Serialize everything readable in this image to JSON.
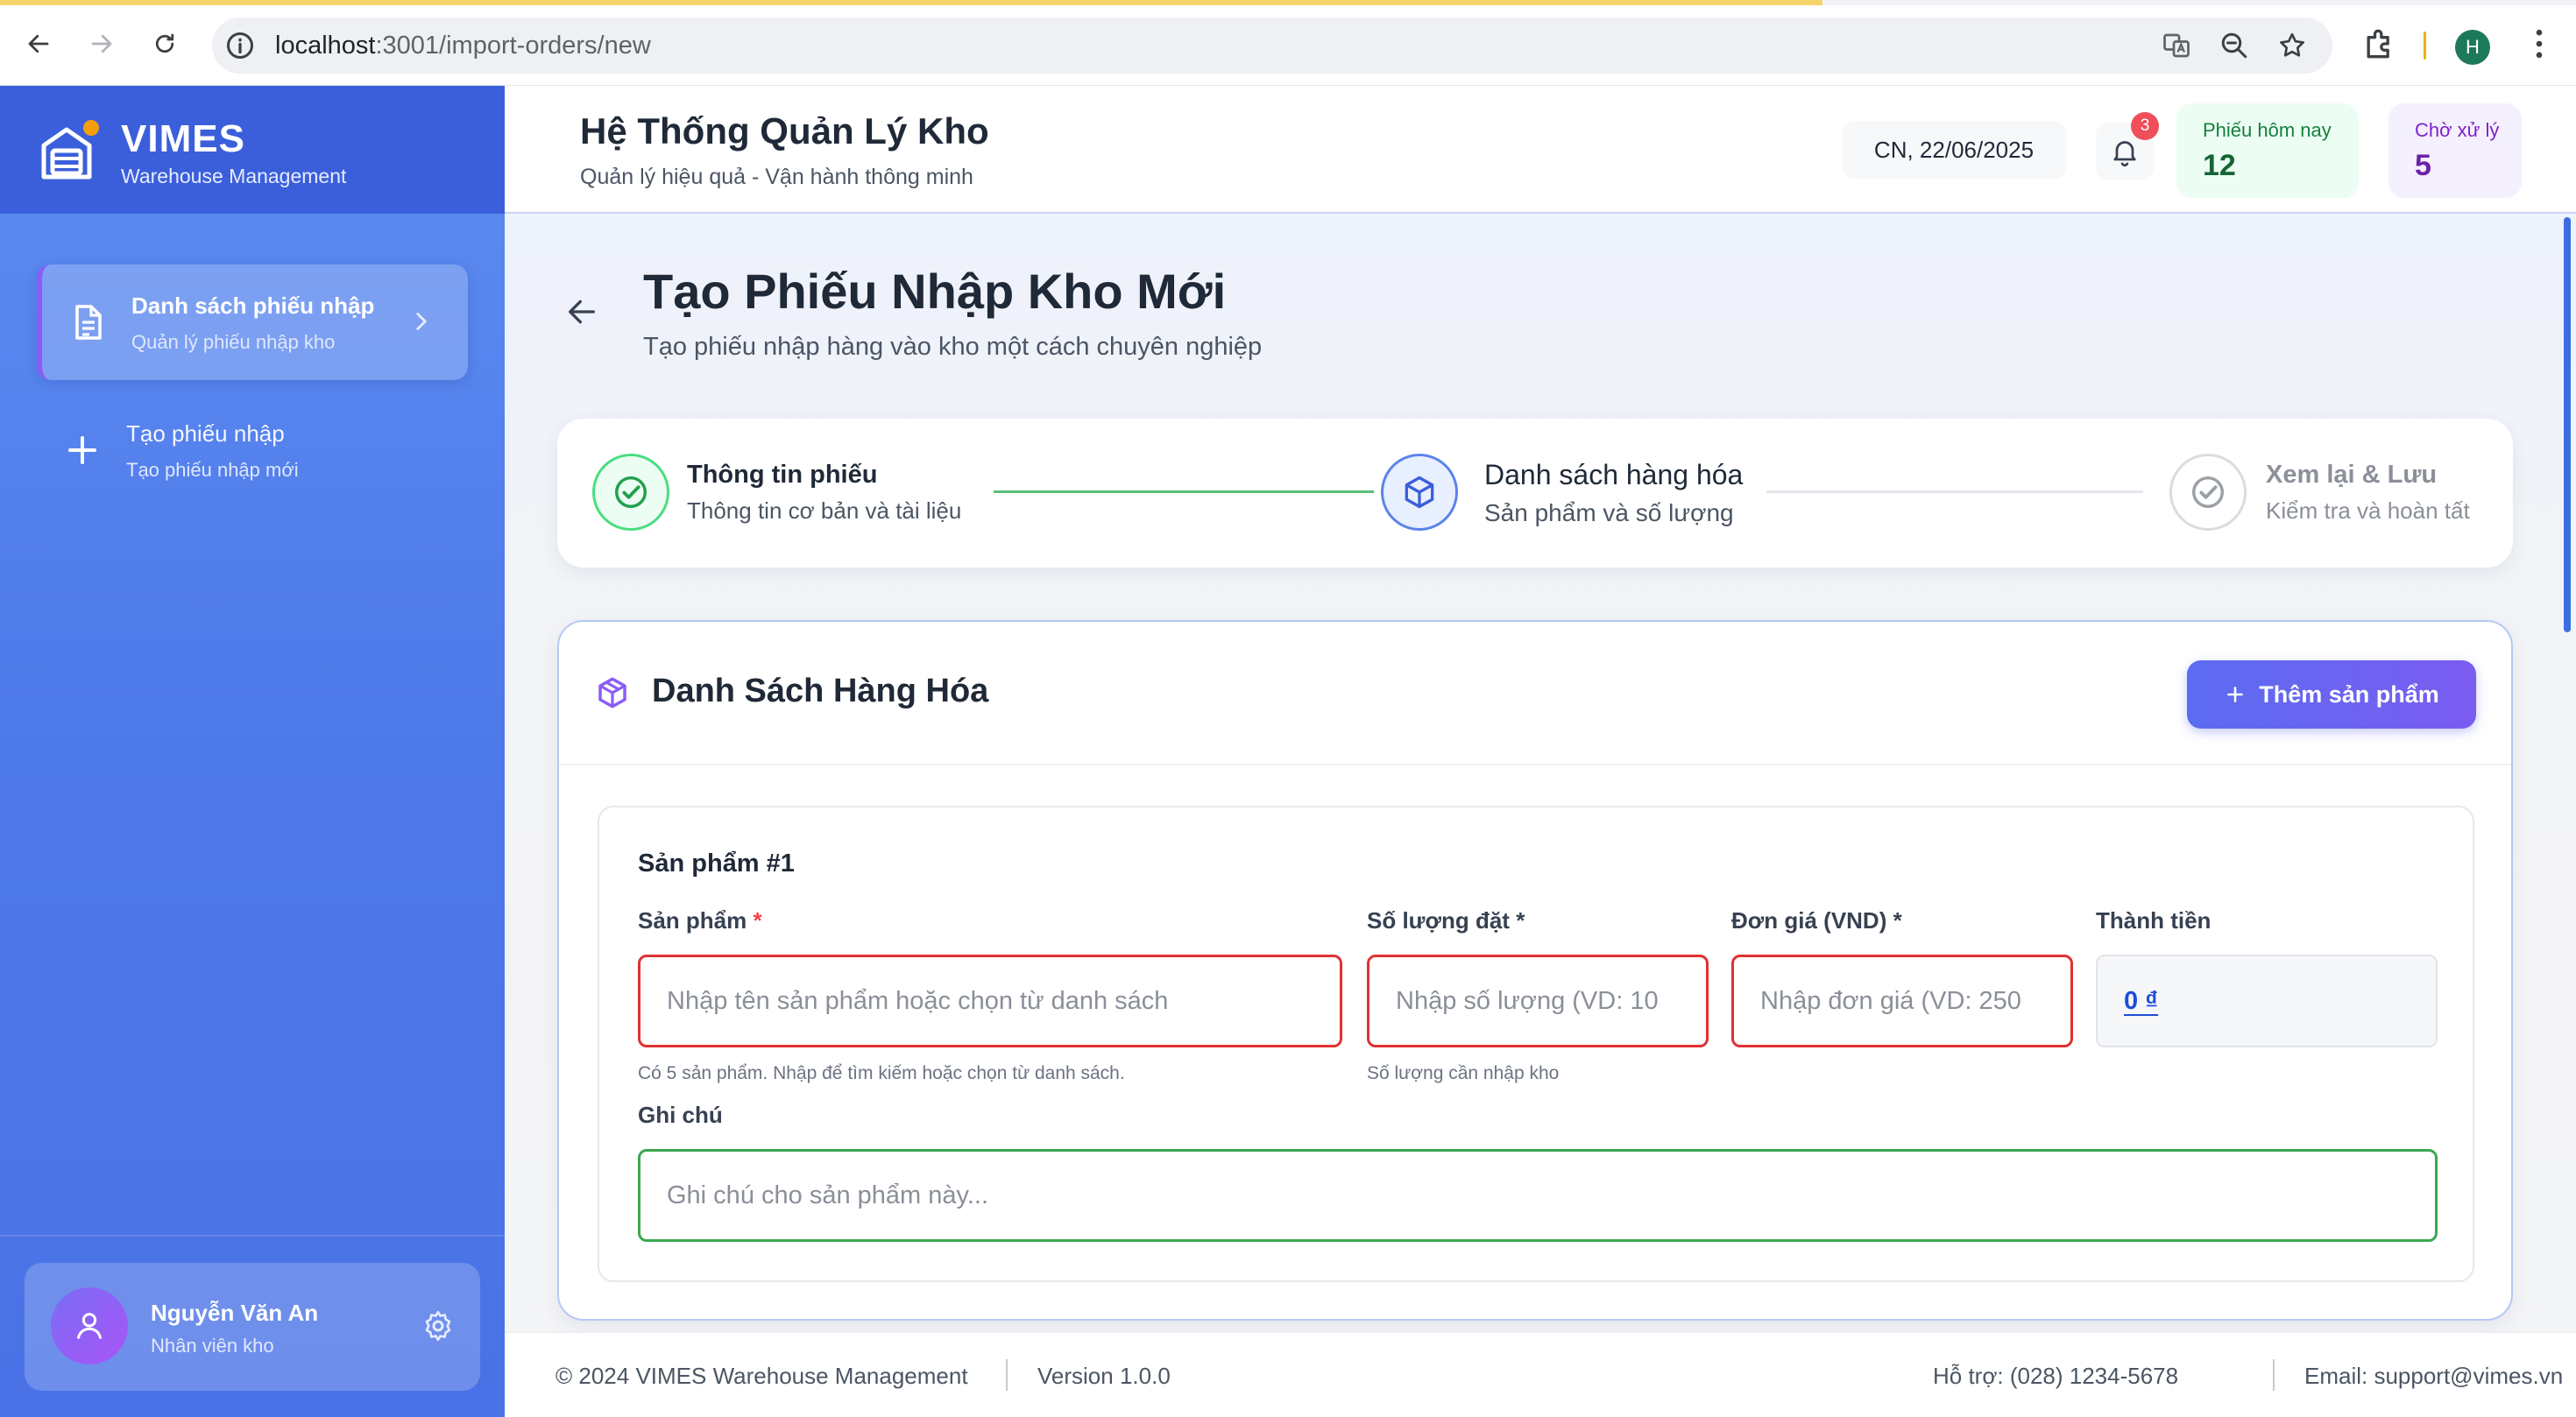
{
  "browser": {
    "url_host": "localhost",
    "url_path": ":3001/import-orders/new",
    "profile_initial": "H"
  },
  "brand": {
    "name": "VIMES",
    "subtitle": "Warehouse Management"
  },
  "sidebar": {
    "items": [
      {
        "label": "Danh sách phiếu nhập",
        "sub": "Quản lý phiếu nhập kho",
        "active": true,
        "icon": "document-icon"
      },
      {
        "label": "Tạo phiếu nhập",
        "sub": "Tạo phiếu nhập mới",
        "active": false,
        "icon": "plus-icon"
      }
    ],
    "user": {
      "name": "Nguyễn Văn An",
      "role": "Nhân viên kho"
    }
  },
  "header": {
    "title": "Hệ Thống Quản Lý Kho",
    "subtitle": "Quản lý hiệu quả - Vận hành thông minh",
    "date": "CN, 22/06/2025",
    "notifications": "3",
    "stats": [
      {
        "label": "Phiếu hôm nay",
        "value": "12",
        "color": "#15803d"
      },
      {
        "label": "Chờ xử lý",
        "value": "5",
        "color": "#7e22ce"
      }
    ]
  },
  "page": {
    "title": "Tạo Phiếu Nhập Kho Mới",
    "subtitle": "Tạo phiếu nhập hàng vào kho một cách chuyên nghiệp"
  },
  "stepper": {
    "steps": [
      {
        "title": "Thông tin phiếu",
        "sub": "Thông tin cơ bản và tài liệu",
        "state": "done"
      },
      {
        "title": "Danh sách hàng hóa",
        "sub": "Sản phẩm và số lượng",
        "state": "current"
      },
      {
        "title": "Xem lại & Lưu",
        "sub": "Kiểm tra và hoàn tất",
        "state": "pending"
      }
    ]
  },
  "goods": {
    "title": "Danh Sách Hàng Hóa",
    "add_button": "Thêm sản phẩm",
    "product": {
      "title": "Sản phẩm #1",
      "product_label": "Sản phẩm",
      "product_placeholder": "Nhập tên sản phẩm hoặc chọn từ danh sách",
      "product_help": "Có 5 sản phẩm. Nhập để tìm kiếm hoặc chọn từ danh sách.",
      "qty_label": "Số lượng đặt *",
      "qty_placeholder": "Nhập số lượng (VD: 10",
      "qty_help": "Số lượng cần nhập kho",
      "price_label": "Đơn giá (VND) *",
      "price_placeholder": "Nhập đơn giá (VD: 250",
      "total_label": "Thành tiền",
      "total_value": "0 ₫",
      "note_label": "Ghi chú",
      "note_placeholder": "Ghi chú cho sản phẩm này..."
    }
  },
  "footer": {
    "copyright": "© 2024 VIMES Warehouse Management",
    "version": "Version 1.0.0",
    "support": "Hỗ trợ: (028) 1234-5678",
    "email": "Email: support@vimes.vn"
  },
  "colors": {
    "sidebar": "#4e79ea",
    "brand_bar": "#3b5fdb",
    "accent": "#6366f1",
    "error_border": "#e03131",
    "success_border": "#3aa84f"
  }
}
